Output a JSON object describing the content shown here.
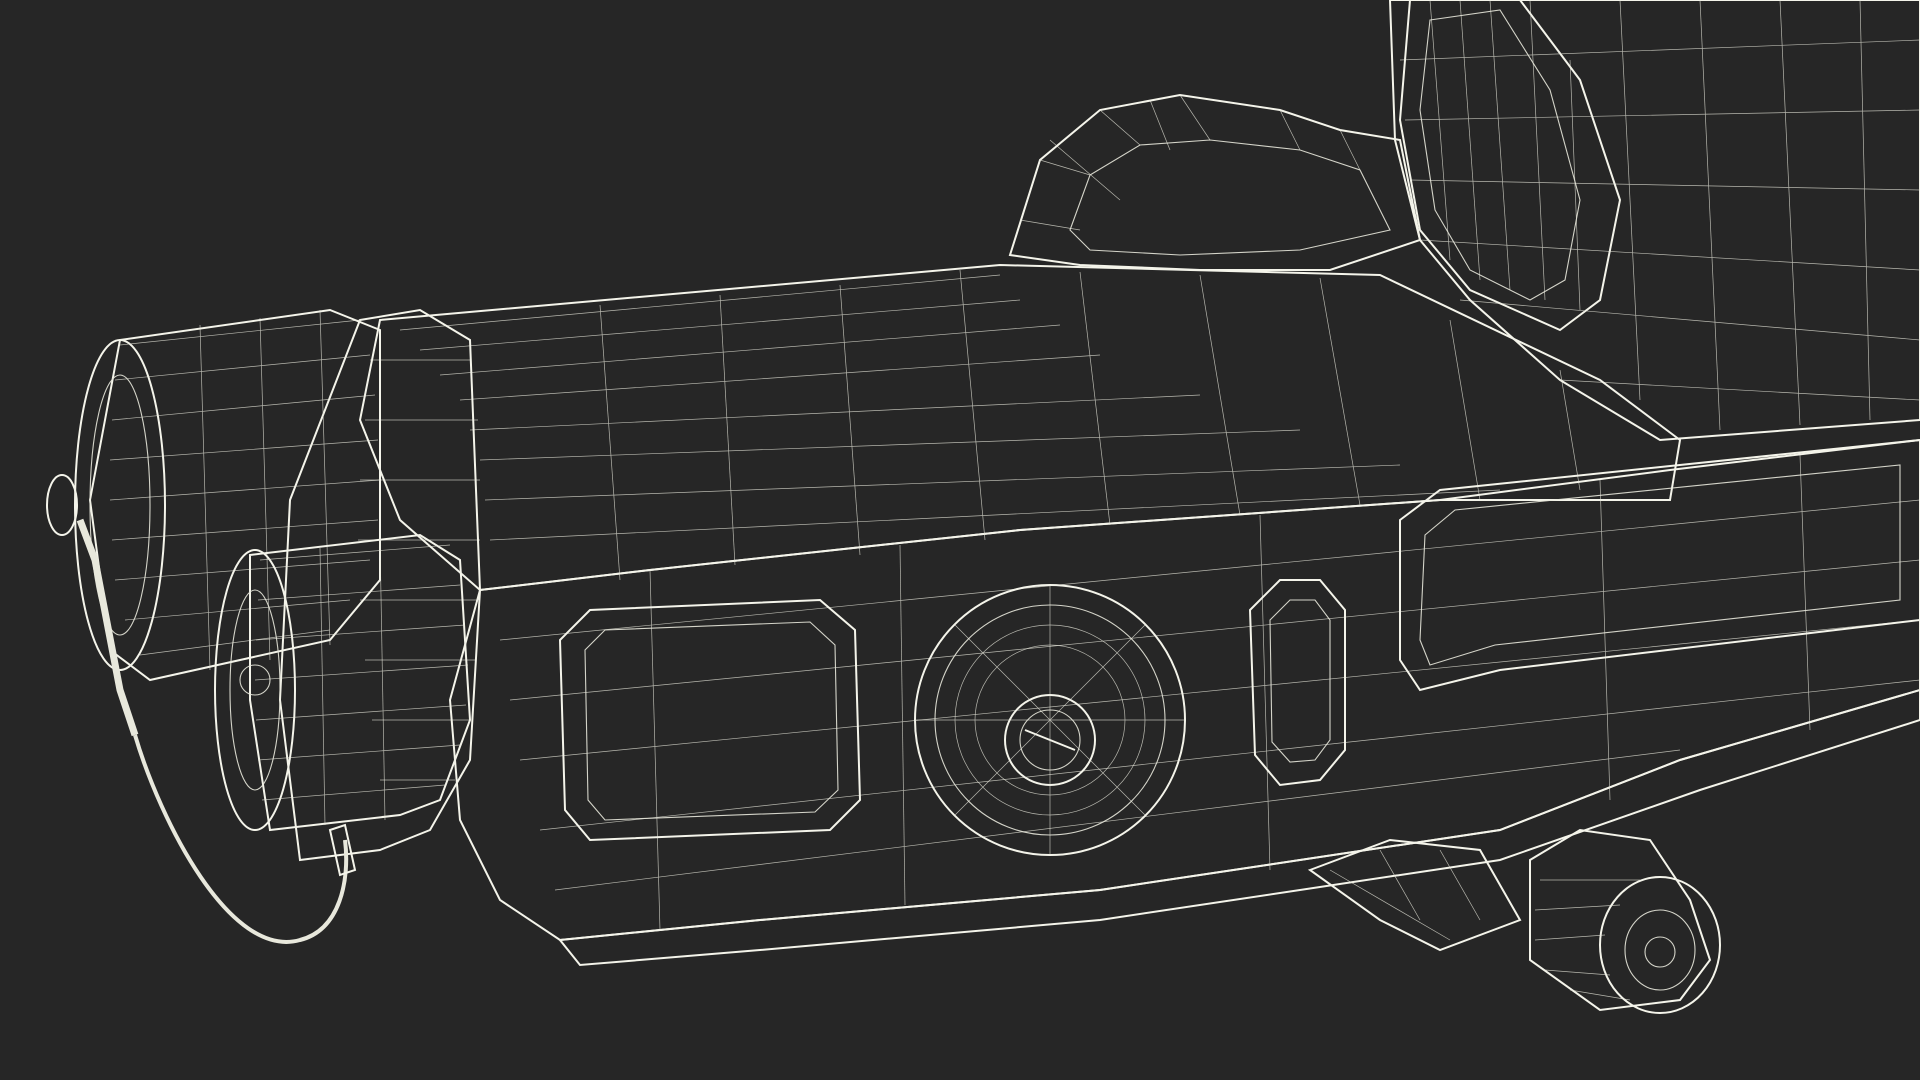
{
  "scene": {
    "subject": "wireframe-3d-model",
    "colors": {
      "background": "#262626",
      "surface": "#7d7e72",
      "surface_dark": "#66675d",
      "surface_light": "#8b8c80",
      "wire": "#e8e8dc"
    }
  }
}
